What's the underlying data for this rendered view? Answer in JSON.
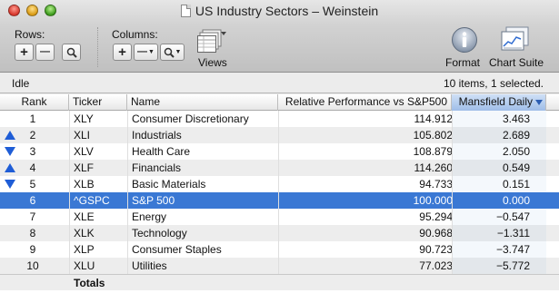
{
  "window": {
    "title": "US Industry Sectors – Weinstein"
  },
  "toolbar": {
    "rows_label": "Rows:",
    "columns_label": "Columns:",
    "add_symbol": "+",
    "remove_symbol": "—",
    "views_label": "Views",
    "format_label": "Format",
    "chart_suite_label": "Chart Suite"
  },
  "status": {
    "left": "Idle",
    "right": "10 items, 1 selected."
  },
  "table": {
    "headers": {
      "rank": "Rank",
      "ticker": "Ticker",
      "name": "Name",
      "rel": "Relative Performance vs S&P500",
      "mansfield": "Mansfield Daily"
    },
    "sorted_column": "mansfield",
    "selection_color": "#3a78d4",
    "arrow_color": "#1f5dd6",
    "rows": [
      {
        "arrow": "",
        "rank": "1",
        "ticker": "XLY",
        "name": "Consumer Discretionary",
        "rel": "114.912",
        "mansfield": "3.463"
      },
      {
        "arrow": "up",
        "rank": "2",
        "ticker": "XLI",
        "name": "Industrials",
        "rel": "105.802",
        "mansfield": "2.689"
      },
      {
        "arrow": "down",
        "rank": "3",
        "ticker": "XLV",
        "name": "Health Care",
        "rel": "108.879",
        "mansfield": "2.050"
      },
      {
        "arrow": "up",
        "rank": "4",
        "ticker": "XLF",
        "name": "Financials",
        "rel": "114.260",
        "mansfield": "0.549"
      },
      {
        "arrow": "down",
        "rank": "5",
        "ticker": "XLB",
        "name": "Basic Materials",
        "rel": "94.733",
        "mansfield": "0.151"
      },
      {
        "arrow": "",
        "rank": "6",
        "ticker": "^GSPC",
        "name": "S&P 500",
        "rel": "100.000",
        "mansfield": "0.000",
        "selected": true
      },
      {
        "arrow": "",
        "rank": "7",
        "ticker": "XLE",
        "name": "Energy",
        "rel": "95.294",
        "mansfield": "−0.547"
      },
      {
        "arrow": "",
        "rank": "8",
        "ticker": "XLK",
        "name": "Technology",
        "rel": "90.968",
        "mansfield": "−1.311"
      },
      {
        "arrow": "",
        "rank": "9",
        "ticker": "XLP",
        "name": "Consumer Staples",
        "rel": "90.723",
        "mansfield": "−3.747"
      },
      {
        "arrow": "",
        "rank": "10",
        "ticker": "XLU",
        "name": "Utilities",
        "rel": "77.023",
        "mansfield": "−5.772"
      }
    ],
    "totals_label": "Totals"
  },
  "icons": {
    "rows_add": "plus-icon",
    "rows_remove": "minus-icon",
    "rows_find": "magnifier-icon",
    "views": "views-icon",
    "format": "info-icon",
    "chart_suite": "chart-suite-icon"
  }
}
